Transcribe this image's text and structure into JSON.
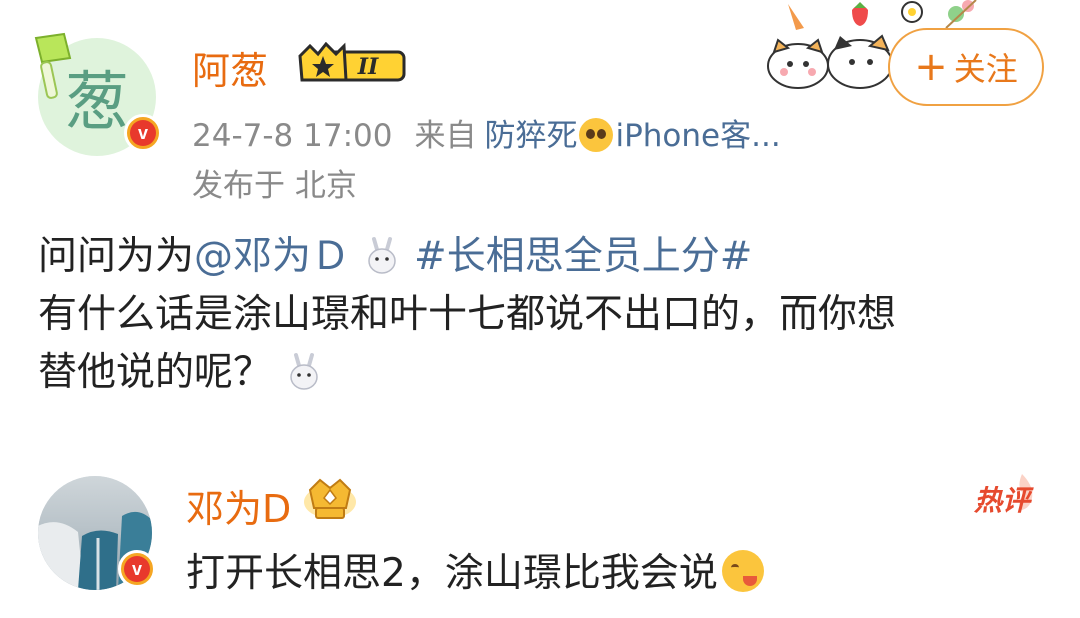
{
  "post": {
    "author": {
      "name": "阿葱",
      "avatar_glyph": "葱",
      "verified_icon": "v-badge-icon",
      "level_badge_icon": "crown-level-badge-icon"
    },
    "timestamp": "24-7-8 17:00",
    "from_label": "来自",
    "device": "防猝死",
    "device_suffix": "iPhone客...",
    "location": "发布于 北京",
    "follow_button": {
      "plus": "+",
      "label": "关注"
    },
    "body": {
      "line1_prefix": "问问为为",
      "mention": "@邓为Ｄ",
      "hashtag": "#长相思全员上分#",
      "line2": "有什么话是涂山璟和叶十七都说不出口的，而你想",
      "line3": "替他说的呢？"
    }
  },
  "comment": {
    "author": {
      "name": "邓为D",
      "verified_icon": "v-badge-icon",
      "badge_icon": "crown-badge-icon"
    },
    "hot_tag": "热评",
    "text": "打开长相思2，涂山璟比我会说"
  },
  "colors": {
    "username": "#e86b10",
    "link": "#4a6d96",
    "meta": "#8a8a8a",
    "follow_border": "#f0a142",
    "hot_tag": "#e64a2e"
  }
}
